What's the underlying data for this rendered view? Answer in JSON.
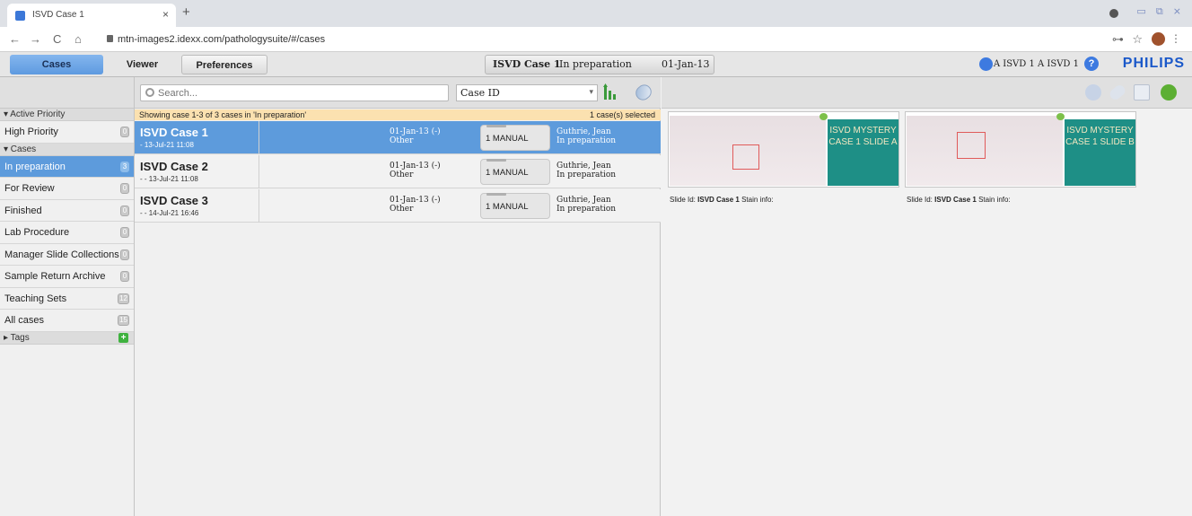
{
  "browser": {
    "tab_title": "ISVD Case 1",
    "tab_close": "×",
    "new_tab": "+",
    "url": "mtn-images2.idexx.com/pathologysuite/#/cases",
    "back": "←",
    "forward": "→",
    "reload": "C",
    "home": "⌂",
    "key_icon": "⊶",
    "star_icon": "☆",
    "menu_icon": "⋮",
    "window_controls": "▭ ⧉ ⨯"
  },
  "app_header": {
    "tabs": [
      "Cases",
      "Viewer",
      "Preferences"
    ],
    "active_tab": "Cases",
    "context_case": "ISVD Case 1",
    "context_status": "In preparation",
    "context_date": "01-Jan-13",
    "user": "A ISVD 1 A ISVD 1",
    "help": "?",
    "brand": "PHILIPS"
  },
  "sidebar": {
    "sections": {
      "active_priority": "▾ Active Priority",
      "cases": "▾ Cases",
      "tags": "▸ Tags"
    },
    "priority_items": [
      {
        "label": "High Priority",
        "count": "0"
      }
    ],
    "case_items": [
      {
        "label": "In preparation",
        "count": "3",
        "selected": true
      },
      {
        "label": "For Review",
        "count": "0"
      },
      {
        "label": "Finished",
        "count": "0"
      },
      {
        "label": "Lab Procedure",
        "count": "0"
      },
      {
        "label": "Manager Slide Collections",
        "count": "0"
      },
      {
        "label": "Sample Return Archive",
        "count": "0"
      },
      {
        "label": "Teaching Sets",
        "count": "12"
      },
      {
        "label": "All cases",
        "count": "15"
      }
    ]
  },
  "list": {
    "search_placeholder": "Search...",
    "sort_field": "Case ID",
    "sort_arrow": "▾",
    "info_text": "Showing case 1-3 of 3 cases in 'In preparation'",
    "selected_text": "1 case(s) selected",
    "rows": [
      {
        "name": "ISVD Case 1",
        "sub": "-  13-Jul-21 11:08",
        "date": "01-Jan-13 (-)",
        "type": "Other",
        "slides": "1  MANUAL",
        "owner": "Guthrie, Jean",
        "status": "In preparation",
        "selected": true
      },
      {
        "name": "ISVD Case 2",
        "sub": "-  - 13-Jul-21 11:08",
        "date": "01-Jan-13 (-)",
        "type": "Other",
        "slides": "1  MANUAL",
        "owner": "Guthrie, Jean",
        "status": "In preparation",
        "selected": false
      },
      {
        "name": "ISVD Case 3",
        "sub": "-  - 14-Jul-21 16:46",
        "date": "01-Jan-13 (-)",
        "type": "Other",
        "slides": "1  MANUAL",
        "owner": "Guthrie, Jean",
        "status": "In preparation",
        "selected": false
      }
    ]
  },
  "slides": [
    {
      "slide_id_label": "Slide Id:",
      "slide_id": "ISVD Case 1",
      "stain_label": "Stain info:",
      "label_text": "ISVD MYSTERY CASE 1 SLIDE A"
    },
    {
      "slide_id_label": "Slide Id:",
      "slide_id": "ISVD Case 1",
      "stain_label": "Stain info:",
      "label_text": "ISVD MYSTERY CASE 1 SLIDE B"
    }
  ],
  "colors": {
    "accent": "#5d9bdc",
    "info_bar": "#fbe1b0",
    "brand": "#1a58c9"
  }
}
